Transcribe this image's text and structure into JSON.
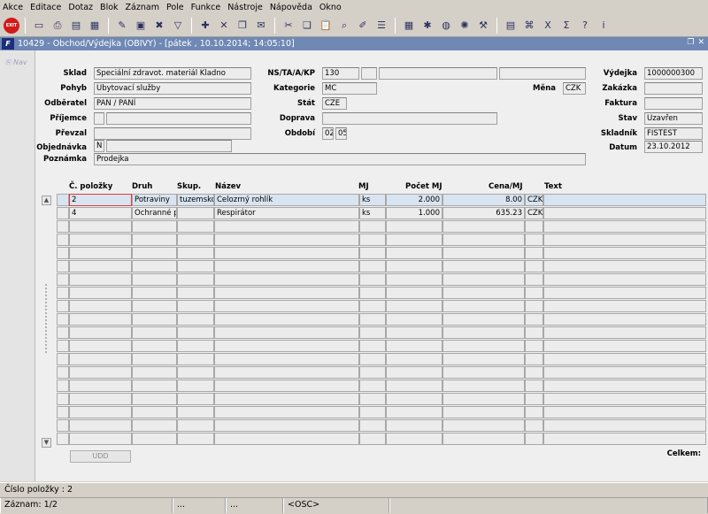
{
  "menu": [
    "Akce",
    "Editace",
    "Dotaz",
    "Blok",
    "Záznam",
    "Pole",
    "Funkce",
    "Nástroje",
    "Nápověda",
    "Okno"
  ],
  "toolbar": {
    "exit_label": "EXIT",
    "groups": [
      [
        "save-icon",
        "print-icon",
        "clear-form-icon",
        "clear-record-icon"
      ],
      [
        "enter-query-icon",
        "execute-query-icon",
        "cancel-query-icon",
        "filter-icon"
      ],
      [
        "insert-record-icon",
        "delete-record-icon",
        "duplicate-icon",
        "mail-icon"
      ],
      [
        "cut-icon",
        "copy-icon",
        "paste-icon",
        "find-icon",
        "edit-icon",
        "list-icon"
      ],
      [
        "calculator-icon",
        "gear-icon",
        "globe-icon",
        "wheel-icon",
        "tools-icon"
      ],
      [
        "report-icon",
        "attach-icon",
        "excel-icon",
        "sum-icon",
        "help-icon",
        "info-icon"
      ]
    ],
    "glyphs": {
      "save-icon": "▭",
      "print-icon": "⎙",
      "clear-form-icon": "▤",
      "clear-record-icon": "▦",
      "enter-query-icon": "✎",
      "execute-query-icon": "▣",
      "cancel-query-icon": "✖",
      "filter-icon": "▽",
      "insert-record-icon": "✚",
      "delete-record-icon": "✕",
      "duplicate-icon": "❐",
      "mail-icon": "✉",
      "cut-icon": "✂",
      "copy-icon": "❏",
      "paste-icon": "📋",
      "find-icon": "⌕",
      "edit-icon": "✐",
      "list-icon": "☰",
      "calculator-icon": "▦",
      "gear-icon": "✱",
      "globe-icon": "◍",
      "wheel-icon": "✺",
      "tools-icon": "⚒",
      "report-icon": "▤",
      "attach-icon": "⌘",
      "excel-icon": "X",
      "sum-icon": "Σ",
      "help-icon": "?",
      "info-icon": "i"
    }
  },
  "window": {
    "logo": "F",
    "title": "10429 - Obchod/Výdejka (OBIVY) - [pátek , 10.10.2014; 14:05:10]",
    "restore": "❐",
    "close": "✕"
  },
  "nav": {
    "label": "Nav"
  },
  "header": {
    "sklad_label": "Sklad",
    "sklad_value": "Speciální zdravot. materiál Kladno",
    "pohyb_label": "Pohyb",
    "pohyb_value": "Ubytovací služby",
    "odberatel_label": "Odběratel",
    "odberatel_value": "PAN / PANÍ",
    "prijemce_label": "Příjemce",
    "prijemce_value": "",
    "prevzal_label": "Převzal",
    "prevzal_value": "",
    "objednavka_label": "Objednávka",
    "objednavka_value": "N",
    "poznamka_label": "Poznámka",
    "poznamka_value": "Prodejka",
    "ns_label": "NS/TA/A/KP",
    "ns_value": "130",
    "kategorie_label": "Kategorie",
    "kategorie_value": "MC",
    "stat_label": "Stát",
    "stat_value": "CZE",
    "doprava_label": "Doprava",
    "doprava_value": "",
    "obdobi_label": "Období",
    "obdobi_month": "02",
    "obdobi_year": "05",
    "mena_label": "Měna",
    "mena_value": "CZK",
    "vydejka_label": "Výdejka",
    "vydejka_value": "1000000300",
    "zakazka_label": "Zakázka",
    "zakazka_value": "",
    "faktura_label": "Faktura",
    "faktura_value": "",
    "stav_label": "Stav",
    "stav_value": "Uzavřen",
    "skladnik_label": "Skladník",
    "skladnik_value": "FISTEST",
    "datum_label": "Datum",
    "datum_value": "23.10.2012"
  },
  "grid": {
    "columns": [
      "Č. položky",
      "Druh",
      "Skup.",
      "Název",
      "MJ",
      "Počet MJ",
      "Cena/MJ",
      "Text"
    ],
    "rows": [
      {
        "cislo": "2",
        "druh": "Potraviny",
        "skup": "tuzemsko",
        "nazev": "Celozrný rohlík",
        "mj": "ks",
        "pocet": "2.000",
        "cena": "8.00",
        "mena": "CZK",
        "text": ""
      },
      {
        "cislo": "4",
        "druh": "Ochranné p",
        "skup": "",
        "nazev": "Respirátor",
        "mj": "ks",
        "pocet": "1.000",
        "cena": "635.23",
        "mena": "CZK",
        "text": ""
      }
    ],
    "empty_rows": 17,
    "scroll_up": "▲",
    "scroll_down": "▼"
  },
  "footer": {
    "udd_label": "UDD",
    "celkem_label": "Celkem:"
  },
  "status": {
    "line1": "Číslo položky : 2",
    "record": "Záznam: 1/2",
    "seg2": "...",
    "seg3": "...",
    "osc": "<OSC>"
  }
}
